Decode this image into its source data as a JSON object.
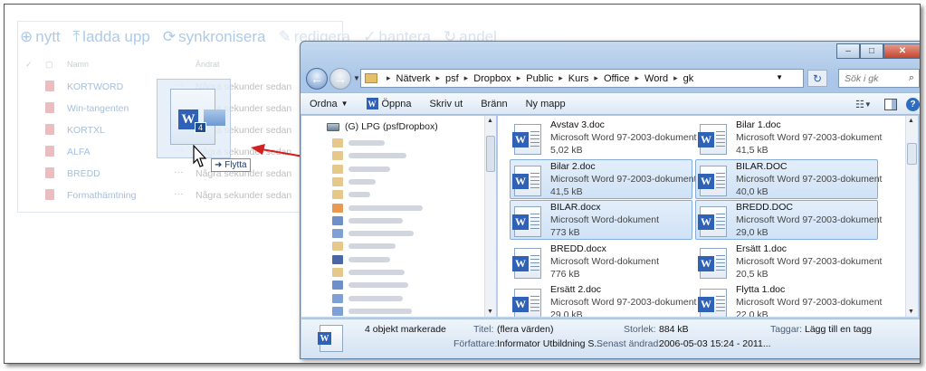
{
  "background_list": {
    "toolbar": [
      {
        "icon": "plus-circle-icon",
        "label": "nytt",
        "enabled": true
      },
      {
        "icon": "upload-icon",
        "label": "ladda upp",
        "enabled": true
      },
      {
        "icon": "sync-icon",
        "label": "synkronisera",
        "enabled": true
      },
      {
        "icon": "pencil-icon",
        "label": "redigera",
        "enabled": false
      },
      {
        "icon": "check-icon",
        "label": "hantera",
        "enabled": false
      },
      {
        "icon": "share-icon",
        "label": "andel",
        "enabled": false
      }
    ],
    "headers": {
      "name": "Namn",
      "modified": "Ändrat"
    },
    "rows": [
      {
        "name": "KORTWORD",
        "modified": "Några sekunder sedan"
      },
      {
        "name": "Win-tangenten",
        "modified": "Några sekunder sedan"
      },
      {
        "name": "KORTXL",
        "modified": "Några sekunder sedan"
      },
      {
        "name": "ALFA",
        "modified": "Några sekunder sedan"
      },
      {
        "name": "BREDD",
        "modified": "Några sekunder sedan"
      },
      {
        "name": "Formathämtning",
        "modified": "Några sekunder sedan"
      }
    ]
  },
  "drag": {
    "badge": "4",
    "label": "Flytta"
  },
  "explorer": {
    "window_buttons": {
      "minimize": "–",
      "maximize": "□",
      "close": "✕"
    },
    "breadcrumb": [
      "Nätverk",
      "psf",
      "Dropbox",
      "Public",
      "Kurs",
      "Office",
      "Word",
      "gk"
    ],
    "search_placeholder": "Sök i gk",
    "commands": {
      "organize": "Ordna",
      "open": "Öppna",
      "print": "Skriv ut",
      "burn": "Bränn",
      "new_folder": "Ny mapp"
    },
    "nav": {
      "drive_label": "(G) LPG (psfDropbox)"
    },
    "files": [
      {
        "name": "Avstav 3.doc",
        "type": "Microsoft Word 97-2003-dokument",
        "size": "5,02 kB",
        "selected": false
      },
      {
        "name": "Bilar 1.doc",
        "type": "Microsoft Word 97-2003-dokument",
        "size": "41,5 kB",
        "selected": false
      },
      {
        "name": "Bilar 2.doc",
        "type": "Microsoft Word 97-2003-dokument",
        "size": "41,5 kB",
        "selected": true
      },
      {
        "name": "BILAR.DOC",
        "type": "Microsoft Word 97-2003-dokument",
        "size": "40,0 kB",
        "selected": true
      },
      {
        "name": "BILAR.docx",
        "type": "Microsoft Word-dokument",
        "size": "773 kB",
        "selected": true
      },
      {
        "name": "BREDD.DOC",
        "type": "Microsoft Word 97-2003-dokument",
        "size": "29,0 kB",
        "selected": true
      },
      {
        "name": "BREDD.docx",
        "type": "Microsoft Word-dokument",
        "size": "776 kB",
        "selected": false
      },
      {
        "name": "Ersätt 1.doc",
        "type": "Microsoft Word 97-2003-dokument",
        "size": "20,5 kB",
        "selected": false
      },
      {
        "name": "Ersätt 2.doc",
        "type": "Microsoft Word 97-2003-dokument",
        "size": "29,0 kB",
        "selected": false
      },
      {
        "name": "Flytta 1.doc",
        "type": "Microsoft Word 97-2003-dokument",
        "size": "22,0 kB",
        "selected": false
      }
    ],
    "details": {
      "count": "4 objekt markerade",
      "title_label": "Titel:",
      "title_value": "(flera värden)",
      "author_label": "Författare:",
      "author_value": "Informator Utbildning S...",
      "size_label": "Storlek:",
      "size_value": "884 kB",
      "modified_label": "Senast ändrad:",
      "modified_value": "2006-05-03 15:24 - 2011...",
      "tags_label": "Taggar:",
      "tags_value": "Lägg till en tagg"
    }
  },
  "colors": {
    "accent": "#2f62b6",
    "arrow": "#d42020",
    "selection": "#cfe2f6"
  }
}
